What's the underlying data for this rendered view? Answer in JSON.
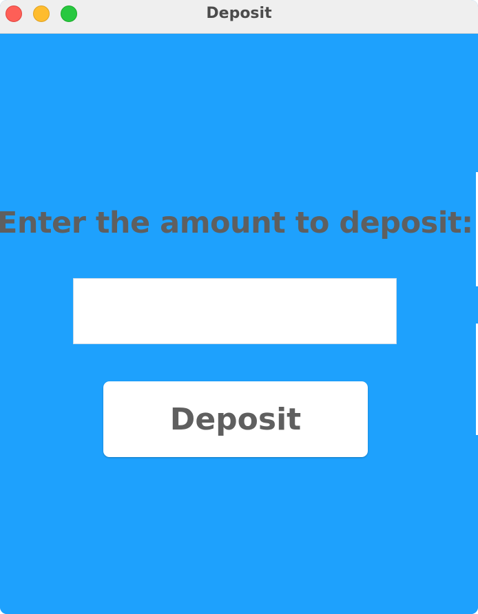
{
  "window": {
    "title": "Deposit"
  },
  "form": {
    "prompt": "Enter the amount to deposit:",
    "amount_value": "",
    "button_label": "Deposit"
  },
  "colors": {
    "background": "#1ea1fd",
    "text": "#5f5f5f",
    "titlebar": "#efefef"
  }
}
